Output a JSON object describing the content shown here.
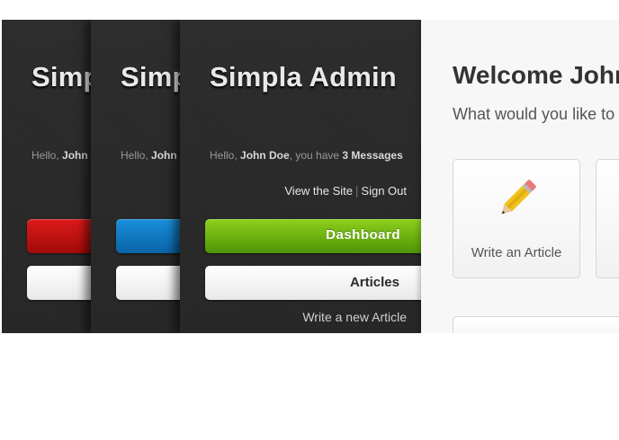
{
  "sidebar": {
    "title": "Simpla Admin",
    "greeting": {
      "prefix": "Hello, ",
      "user": "John Doe",
      "middle": ", you have ",
      "messages": "3 Messages"
    },
    "links": {
      "view_site": "View the Site",
      "separator": "|",
      "sign_out": "Sign Out"
    },
    "nav": {
      "dashboard": "Dashboard",
      "articles": "Articles",
      "write_new_article": "Write a new Article"
    },
    "theme_colors": {
      "red": "#c11414",
      "blue": "#1279c5",
      "green": "#6cb512"
    }
  },
  "main": {
    "welcome": "Welcome John",
    "question": "What would you like to",
    "shortcuts": [
      {
        "label": "Write an Article",
        "icon": "pencil-icon"
      }
    ]
  }
}
